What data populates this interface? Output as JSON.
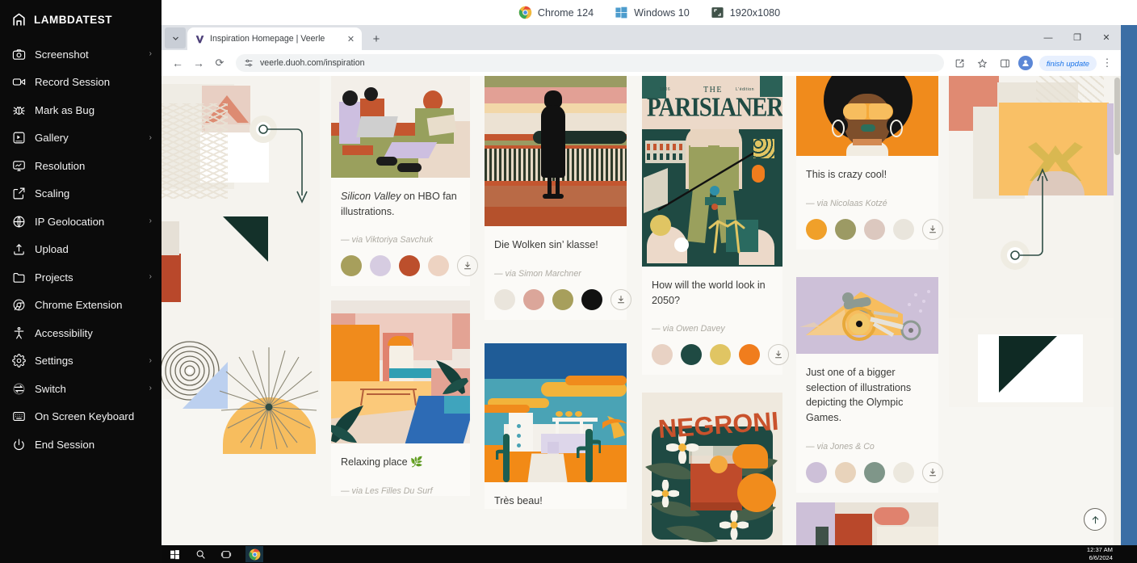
{
  "sidebar": {
    "brand": "LAMBDATEST",
    "items": [
      {
        "label": "Screenshot",
        "icon": "camera-icon",
        "caret": "›"
      },
      {
        "label": "Record Session",
        "icon": "video-camera-icon",
        "caret": ""
      },
      {
        "label": "Mark as Bug",
        "icon": "bug-icon",
        "caret": ""
      },
      {
        "label": "Gallery",
        "icon": "gallery-icon",
        "caret": "›"
      },
      {
        "label": "Resolution",
        "icon": "monitor-icon",
        "caret": ""
      },
      {
        "label": "Scaling",
        "icon": "expand-icon",
        "caret": ""
      },
      {
        "label": "IP Geolocation",
        "icon": "globe-icon",
        "caret": "›"
      },
      {
        "label": "Upload",
        "icon": "upload-icon",
        "caret": ""
      },
      {
        "label": "Projects",
        "icon": "folder-icon",
        "caret": "›"
      },
      {
        "label": "Chrome Extension",
        "icon": "chrome-icon",
        "caret": ""
      },
      {
        "label": "Accessibility",
        "icon": "accessibility-icon",
        "caret": ""
      },
      {
        "label": "Settings",
        "icon": "gear-icon",
        "caret": "›"
      },
      {
        "label": "Switch",
        "icon": "switch-icon",
        "caret": "›"
      },
      {
        "label": "On Screen Keyboard",
        "icon": "keyboard-icon",
        "caret": ""
      },
      {
        "label": "End Session",
        "icon": "power-icon",
        "caret": ""
      }
    ]
  },
  "topstrip": {
    "browser": "Chrome 124",
    "os": "Windows 10",
    "resolution": "1920x1080"
  },
  "browser": {
    "tab_title": "Inspiration Homepage | Veerle",
    "tab_close": "✕",
    "new_tab": "+",
    "window": {
      "minimize": "—",
      "maximize": "❐",
      "close": "✕"
    },
    "nav": {
      "back": "←",
      "forward": "→",
      "reload": "⟳"
    },
    "url": "veerle.duoh.com/inspiration",
    "update_pill": "finish update",
    "kebab": "⋮"
  },
  "page": {
    "scroll_top_label": "↑",
    "columns": [
      {
        "type": "decor",
        "name": "decor-column-left"
      },
      {
        "type": "cards",
        "cards": [
          {
            "name": "card-silicon-valley",
            "title_em": "Silicon Valley",
            "title_rest": " on HBO fan illustrations.",
            "via": "— via Viktoriya Savchuk",
            "swatches": [
              "#a79f5c",
              "#d6cce1",
              "#bc4f2c",
              "#edd3c2"
            ],
            "download": "download-icon"
          },
          {
            "name": "card-relaxing-place",
            "title_em": "",
            "title_rest": "Relaxing place 🌿",
            "via": "— via Les Filles Du Surf",
            "swatches": [],
            "download": ""
          }
        ]
      },
      {
        "type": "cards",
        "cards": [
          {
            "name": "card-die-wolken",
            "title_em": "",
            "title_rest": "Die Wolken sin’ klasse!",
            "via": "— via Simon Marchner",
            "swatches": [
              "#eae5dc",
              "#dba69a",
              "#a79f5c",
              "#111111"
            ],
            "download": "download-icon"
          },
          {
            "name": "card-tres-beau",
            "title_em": "",
            "title_rest": "Très beau!",
            "via": "",
            "swatches": [],
            "download": ""
          }
        ]
      },
      {
        "type": "cards",
        "cards": [
          {
            "name": "card-parisianer",
            "title_em": "",
            "title_rest": "How will the world look in 2050?",
            "via": "— via Owen Davey",
            "swatches": [
              "#e8d2c4",
              "#1f4a43",
              "#e0c563",
              "#f07d1d"
            ],
            "download": "download-icon",
            "poster_kicker_left": "1806",
            "poster_the": "THE",
            "poster_main": "PARISIANER",
            "poster_kicker_right": "L'édition"
          },
          {
            "name": "card-negroni",
            "title_em": "",
            "title_rest": "",
            "via": "",
            "swatches": [],
            "download": "",
            "poster_main": "NEGRONI"
          }
        ]
      },
      {
        "type": "cards",
        "cards": [
          {
            "name": "card-crazy-cool",
            "title_em": "",
            "title_rest": "This is crazy cool!",
            "via": "— via Nicolaas Kotzé",
            "swatches": [
              "#f0a02a",
              "#9c9a64",
              "#dcc8bf",
              "#e9e5dc"
            ],
            "download": "download-icon"
          },
          {
            "name": "card-olympic-games",
            "title_em": "",
            "title_rest": "Just one of a bigger selection of illustrations depicting the Olympic Games.",
            "via": "— via Jones & Co",
            "swatches": [
              "#cdc0d8",
              "#e8d3bb",
              "#7f9689",
              "#ece8de"
            ],
            "download": "download-icon"
          }
        ]
      },
      {
        "type": "decor",
        "name": "decor-column-right"
      }
    ]
  },
  "taskbar": {
    "start": "start-icon",
    "search": "search-icon",
    "taskview": "task-view-icon",
    "chrome": "chrome-icon",
    "time": "12:37 AM",
    "date": "6/6/2024"
  }
}
